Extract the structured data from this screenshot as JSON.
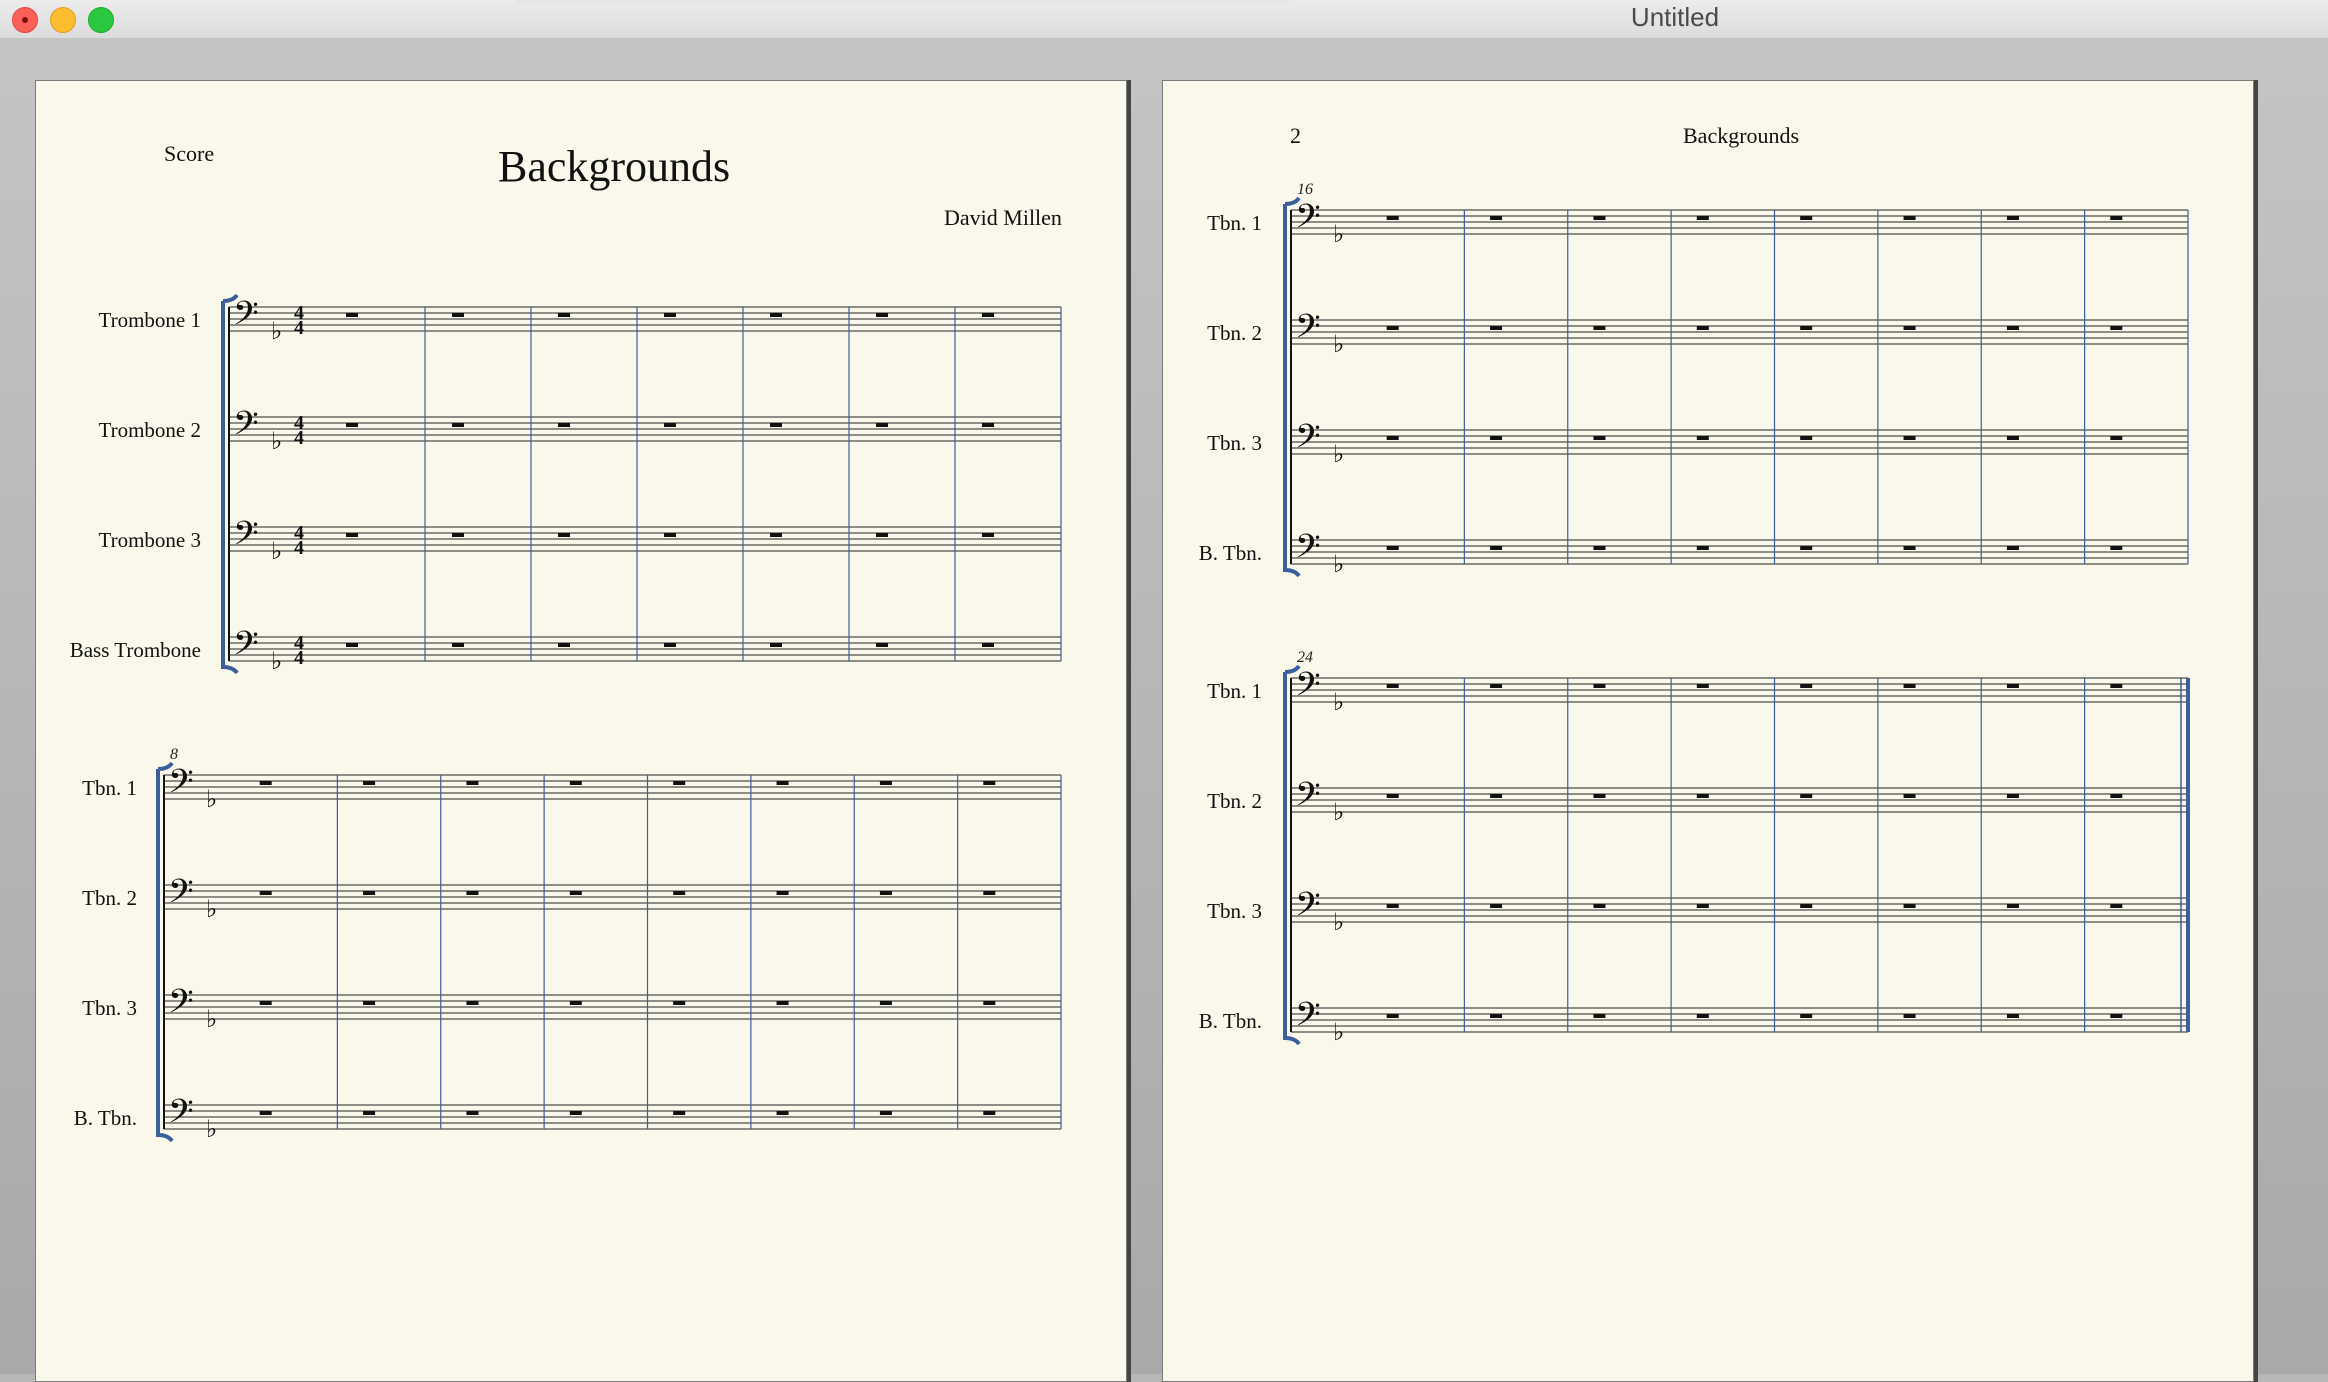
{
  "window": {
    "title": "Untitled"
  },
  "page1": {
    "header_left": "Score",
    "title": "Backgrounds",
    "composer": "David Millen",
    "systems": [
      {
        "start_measure": "",
        "instruments": [
          "Trombone 1",
          "Trombone 2",
          "Trombone 3",
          "Bass Trombone"
        ],
        "time_signature": "4/4",
        "measures": 7
      },
      {
        "start_measure": "8",
        "instruments": [
          "Tbn. 1",
          "Tbn. 2",
          "Tbn. 3",
          "B. Tbn."
        ],
        "time_signature": "",
        "measures": 8
      }
    ]
  },
  "page2": {
    "page_number": "2",
    "running_title": "Backgrounds",
    "systems": [
      {
        "start_measure": "16",
        "instruments": [
          "Tbn. 1",
          "Tbn. 2",
          "Tbn. 3",
          "B. Tbn."
        ],
        "time_signature": "",
        "measures": 8
      },
      {
        "start_measure": "24",
        "instruments": [
          "Tbn. 1",
          "Tbn. 2",
          "Tbn. 3",
          "B. Tbn."
        ],
        "time_signature": "",
        "measures": 8,
        "final_barline": true
      }
    ]
  },
  "colors": {
    "barline": "#3b5f9c",
    "staff": "#222222",
    "paper": "#f9f8ea"
  },
  "key_signature": "one flat",
  "clef": "bass-clef-icon"
}
